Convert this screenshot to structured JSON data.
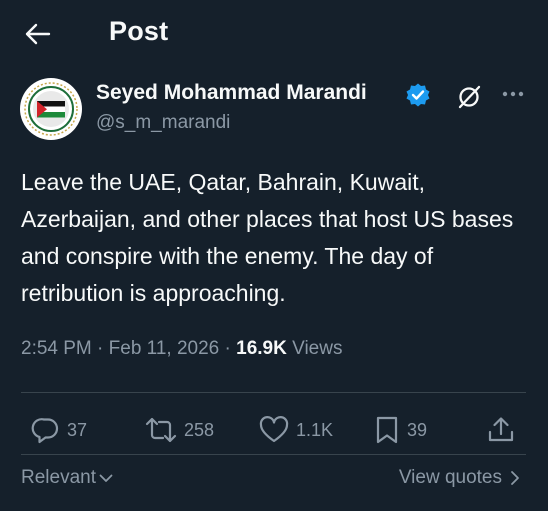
{
  "header": {
    "title": "Post",
    "back_icon": "arrow-left-icon"
  },
  "author": {
    "name": "Seyed Mohammad Marandi",
    "handle": "@s_m_marandi",
    "verified_color": "#1d9bf0"
  },
  "post": {
    "text": "Leave the UAE, Qatar, Bahrain, Kuwait, Azerbaijan, and other places that host US bases and conspire with the enemy. The day of retribution is approaching.",
    "time": "2:54 PM",
    "separator": "·",
    "date": "Feb 11, 2026",
    "views_count": "16.9K",
    "views_label": "Views"
  },
  "actions": {
    "replies": "37",
    "reposts": "258",
    "likes": "1.1K",
    "bookmarks": "39"
  },
  "footer": {
    "sort_label": "Relevant",
    "view_quotes_label": "View quotes"
  },
  "colors": {
    "background": "#15202b",
    "text": "#f7f9f9",
    "secondary": "#8b98a5",
    "divider": "#38444d"
  }
}
